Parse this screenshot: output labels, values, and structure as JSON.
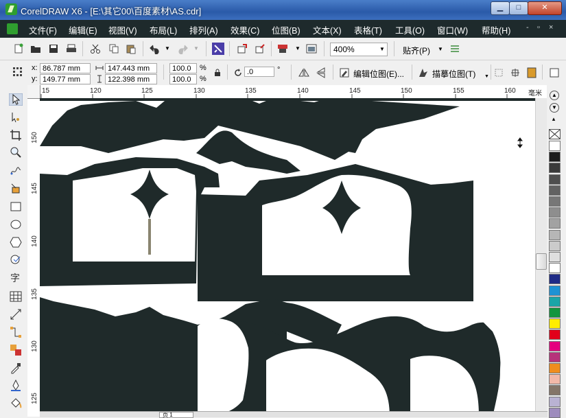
{
  "window": {
    "title": "CorelDRAW X6 - [E:\\其它00\\百度素材\\AS.cdr]",
    "min_label": "▁",
    "max_label": "□",
    "close_label": "✕"
  },
  "menu": {
    "items": [
      "文件(F)",
      "编辑(E)",
      "视图(V)",
      "布局(L)",
      "排列(A)",
      "效果(C)",
      "位图(B)",
      "文本(X)",
      "表格(T)",
      "工具(O)",
      "窗口(W)",
      "帮助(H)"
    ],
    "mdi_min": "-",
    "mdi_restore": "▫",
    "mdi_close": "×"
  },
  "toolbar": {
    "zoom_value": "400%",
    "snap_label": "贴齐(P)",
    "dropdown_arrow": "▼"
  },
  "properties": {
    "x_label": "x:",
    "x_value": "86.787 mm",
    "y_label": "y:",
    "y_value": "149.77 mm",
    "width_value": "147.443 mm",
    "height_value": "122.398 mm",
    "scale_x": "100.0",
    "scale_y": "100.0",
    "percent": "%",
    "rotation_value": ".0",
    "degree": "°",
    "edit_bitmap_label": "编辑位图(E)...",
    "trace_bitmap_label": "描摹位图(T)"
  },
  "ruler": {
    "top_ticks": [
      "15",
      "120",
      "125",
      "130",
      "135",
      "140",
      "145",
      "150",
      "155",
      "160"
    ],
    "left_ticks": [
      "150",
      "145",
      "140",
      "135",
      "130",
      "125"
    ],
    "unit": "毫米"
  },
  "toolbox": {
    "text_tool": "字"
  },
  "palette": {
    "colors": [
      "#ffffff",
      "#1c1c1c",
      "#3a3a3a",
      "#4e4e4e",
      "#626262",
      "#777777",
      "#8e8e8e",
      "#a2a2a2",
      "#b6b6b6",
      "#cbcbcb",
      "#dedede",
      "#ffffff",
      "#1f2b86",
      "#1e92d4",
      "#1aa5a8",
      "#12953f",
      "#ffed00",
      "#e2001a",
      "#e4007f",
      "#b6337a",
      "#ef8d1e",
      "#f2b8a8",
      "#847568",
      "#b9b2d3",
      "#9d8bbd"
    ]
  },
  "status": {
    "page_tab": "页 1"
  }
}
